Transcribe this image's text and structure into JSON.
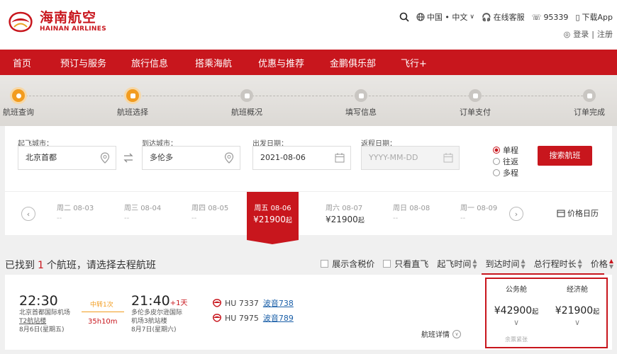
{
  "brand": {
    "name_cn": "海南航空",
    "name_en": "HAINAN AIRLINES",
    "color": "#c8161d"
  },
  "top_links": {
    "region": "中国 • 中文",
    "service": "在线客服",
    "phone": "95339",
    "app": "下载App",
    "login": "登录",
    "register": "注册"
  },
  "nav": [
    "首页",
    "预订与服务",
    "旅行信息",
    "搭乘海航",
    "优惠与推荐",
    "金鹏俱乐部",
    "飞行+"
  ],
  "steps": [
    "航班查询",
    "航班选择",
    "航班概况",
    "填写信息",
    "订单支付",
    "订单完成"
  ],
  "search": {
    "from_label": "起飞城市：",
    "from_value": "北京首都",
    "to_label": "到达城市：",
    "to_value": "多伦多",
    "depart_label": "出发日期：",
    "depart_value": "2021-08-06",
    "return_label": "返程日期：",
    "return_placeholder": "YYYY-MM-DD",
    "trip_types": [
      "单程",
      "往返",
      "多程"
    ],
    "selected_trip": "单程",
    "button": "搜索航班"
  },
  "dates": [
    {
      "day": "周二",
      "date": "08-03",
      "price": "--"
    },
    {
      "day": "周三",
      "date": "08-04",
      "price": "--"
    },
    {
      "day": "周四",
      "date": "08-05",
      "price": "--"
    },
    {
      "day": "周五",
      "date": "08-06",
      "price": "¥21900",
      "unit": "起",
      "active": true
    },
    {
      "day": "周六",
      "date": "08-07",
      "price": "¥21900",
      "unit": "起"
    },
    {
      "day": "周日",
      "date": "08-08",
      "price": "--"
    },
    {
      "day": "周一",
      "date": "08-09",
      "price": "--"
    }
  ],
  "price_calendar": "价格日历",
  "results": {
    "prefix": "已找到",
    "count": "1",
    "suffix": "个航班，请选择去程航班"
  },
  "filters": {
    "tax": "展示含税价",
    "direct": "只看直飞",
    "sorts": [
      "起飞时间",
      "到达时间",
      "总行程时长",
      "价格"
    ]
  },
  "flight": {
    "dep_time": "22:30",
    "dep_airport": "北京首都国际机场",
    "dep_terminal": "T2航站楼",
    "dep_date": "8月6日(星期五)",
    "stop": "中转1次",
    "duration": "35h10m",
    "arr_time": "21:40",
    "arr_plus": "+1天",
    "arr_airport": "多伦多皮尔逊国际机场3航站楼",
    "arr_date": "8月7日(星期六)",
    "legs": [
      {
        "flight": "HU 7337",
        "plane": "波音738"
      },
      {
        "flight": "HU 7975",
        "plane": "波音789"
      }
    ],
    "details": "航班详情",
    "fares": [
      {
        "class": "公务舱",
        "price": "¥42900",
        "unit": "起",
        "note": "余票紧张"
      },
      {
        "class": "经济舱",
        "price": "¥21900",
        "unit": "起"
      }
    ]
  }
}
